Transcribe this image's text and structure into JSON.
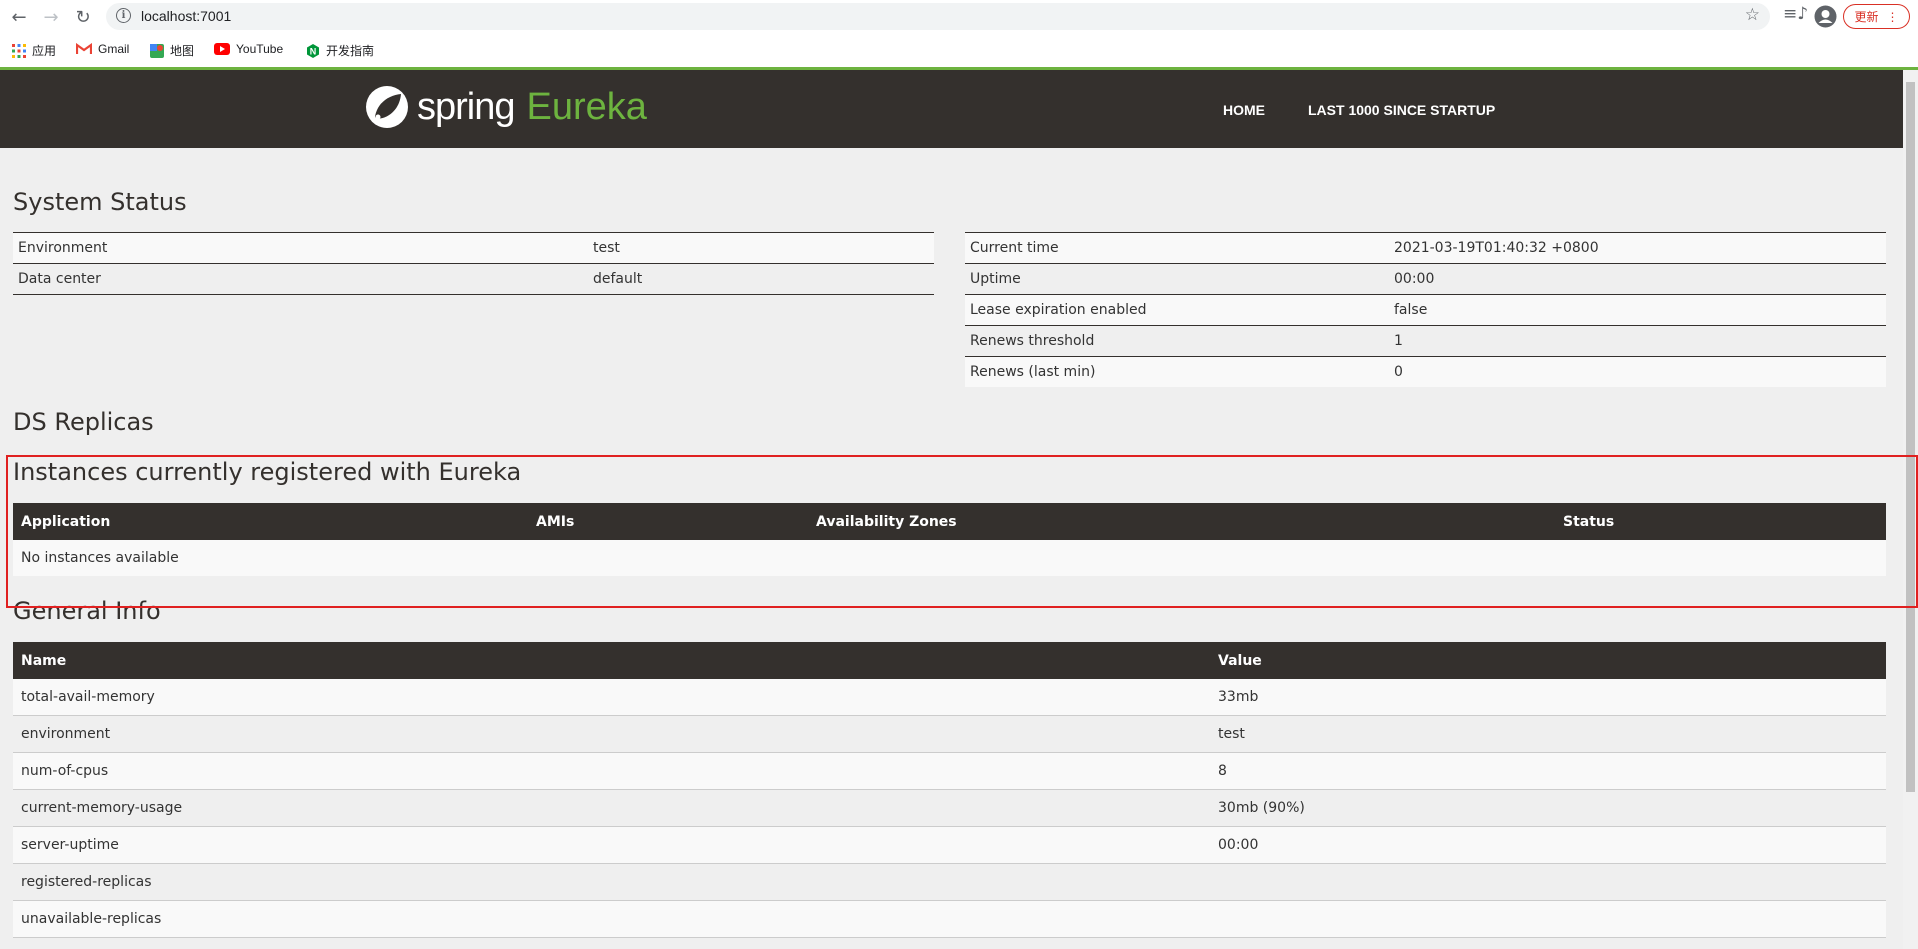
{
  "browser": {
    "url": "localhost:7001",
    "update_label": "更新",
    "bookmarks": [
      {
        "label": "应用",
        "icon": "apps-grid-icon"
      },
      {
        "label": "Gmail",
        "icon": "gmail-icon"
      },
      {
        "label": "地图",
        "icon": "maps-icon"
      },
      {
        "label": "YouTube",
        "icon": "youtube-icon"
      },
      {
        "label": "开发指南",
        "icon": "nginx-icon"
      }
    ]
  },
  "header": {
    "logo_spring": "spring",
    "logo_eureka": "Eureka",
    "nav": [
      "HOME",
      "LAST 1000 SINCE STARTUP"
    ]
  },
  "system_status": {
    "title": "System Status",
    "left": [
      {
        "key": "Environment",
        "value": "test"
      },
      {
        "key": "Data center",
        "value": "default"
      }
    ],
    "right": [
      {
        "key": "Current time",
        "value": "2021-03-19T01:40:32 +0800"
      },
      {
        "key": "Uptime",
        "value": "00:00"
      },
      {
        "key": "Lease expiration enabled",
        "value": "false"
      },
      {
        "key": "Renews threshold",
        "value": "1"
      },
      {
        "key": "Renews (last min)",
        "value": "0"
      }
    ]
  },
  "ds_replicas": {
    "title": "DS Replicas"
  },
  "instances": {
    "title": "Instances currently registered with Eureka",
    "columns": [
      "Application",
      "AMIs",
      "Availability Zones",
      "Status"
    ],
    "empty_text": "No instances available"
  },
  "general_info": {
    "title": "General Info",
    "columns": [
      "Name",
      "Value"
    ],
    "rows": [
      {
        "name": "total-avail-memory",
        "value": "33mb"
      },
      {
        "name": "environment",
        "value": "test"
      },
      {
        "name": "num-of-cpus",
        "value": "8"
      },
      {
        "name": "current-memory-usage",
        "value": "30mb (90%)"
      },
      {
        "name": "server-uptime",
        "value": "00:00"
      },
      {
        "name": "registered-replicas",
        "value": ""
      },
      {
        "name": "unavailable-replicas",
        "value": ""
      }
    ]
  },
  "colors": {
    "brand_green": "#6db33f",
    "header_bg": "#34302d",
    "highlight": "#e02020"
  }
}
